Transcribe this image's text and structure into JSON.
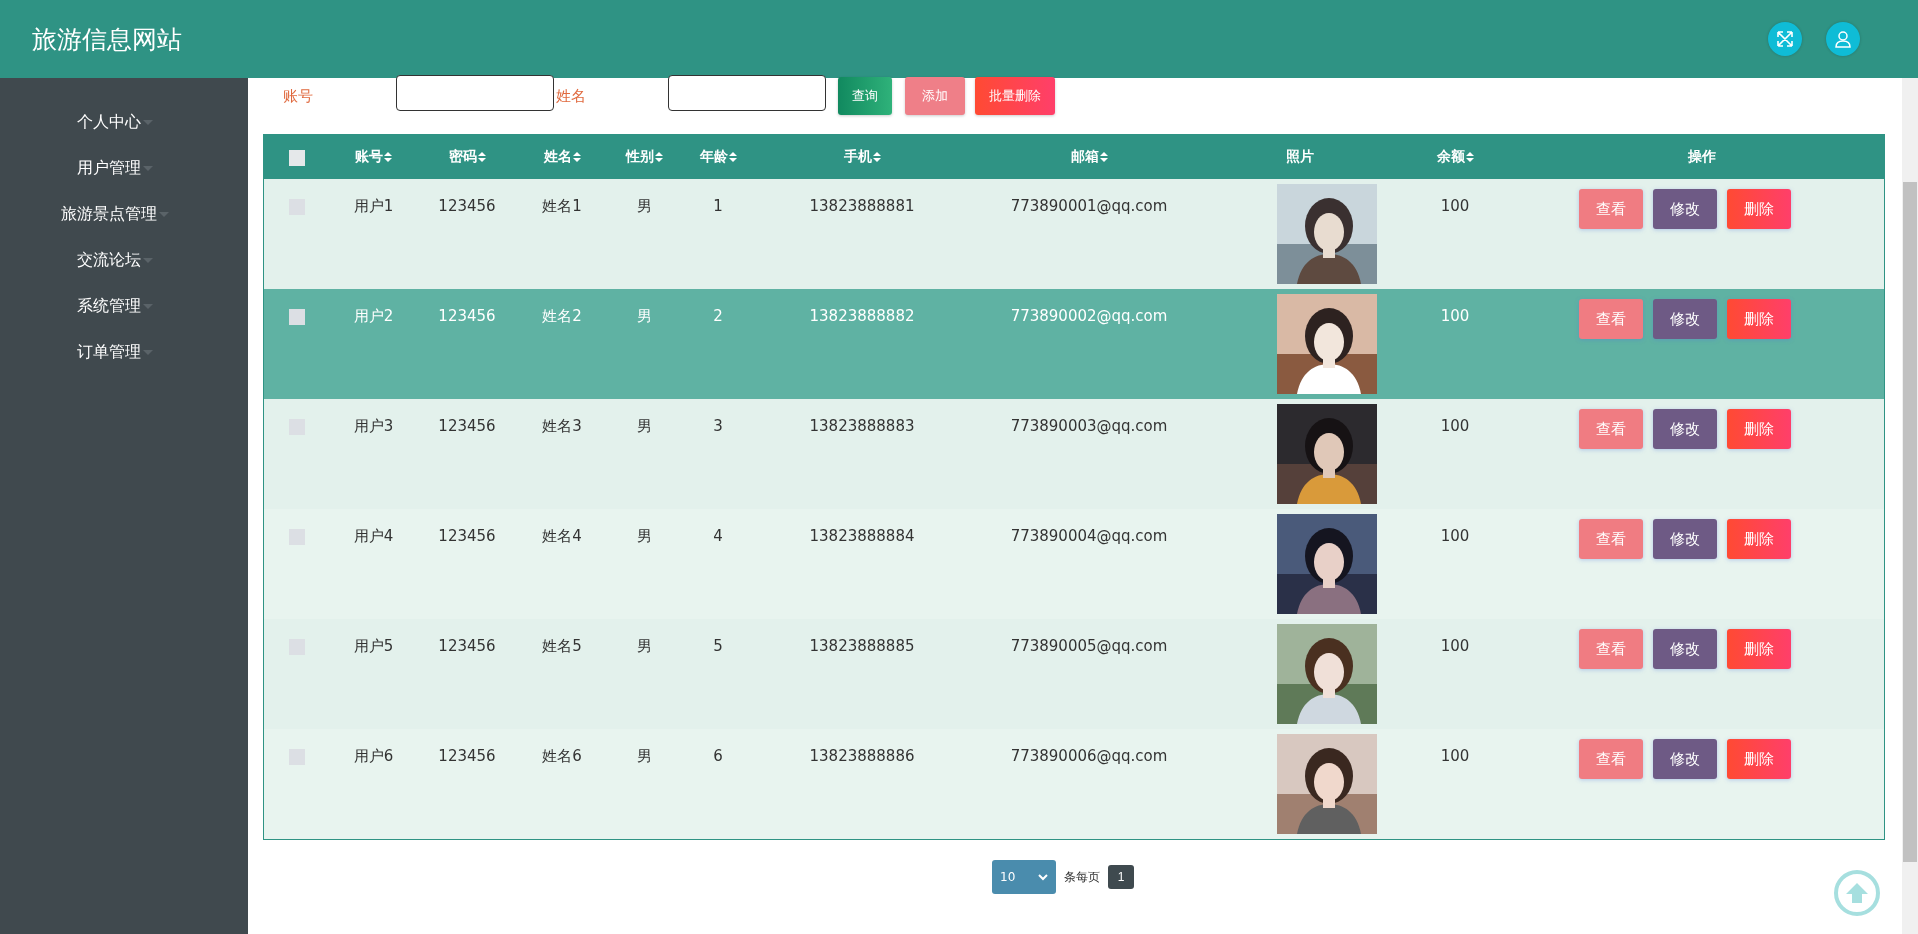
{
  "header": {
    "title": "旅游信息网站"
  },
  "sidebar": {
    "items": [
      {
        "label": "个人中心"
      },
      {
        "label": "用户管理"
      },
      {
        "label": "旅游景点管理"
      },
      {
        "label": "交流论坛"
      },
      {
        "label": "系统管理"
      },
      {
        "label": "订单管理"
      }
    ]
  },
  "search": {
    "fields": [
      {
        "label": "账号"
      },
      {
        "label": "姓名"
      }
    ],
    "buttons": [
      {
        "label": "查询",
        "kind": "query"
      },
      {
        "label": "添加",
        "kind": "add"
      },
      {
        "label": "批量删除",
        "kind": "delete"
      }
    ]
  },
  "table": {
    "select_all": {
      "checked": false
    },
    "columns": [
      {
        "label": "账号",
        "sortable": true
      },
      {
        "label": "密码",
        "sortable": true
      },
      {
        "label": "姓名",
        "sortable": true
      },
      {
        "label": "性别",
        "sortable": true
      },
      {
        "label": "年龄",
        "sortable": true
      },
      {
        "label": "手机",
        "sortable": true
      },
      {
        "label": "邮箱",
        "sortable": true
      },
      {
        "label": "照片",
        "sortable": false
      },
      {
        "label": "余额",
        "sortable": true
      },
      {
        "label": "操作",
        "sortable": false
      }
    ],
    "rows": [
      {
        "checked": false,
        "highlighted": false,
        "cells": [
          "用户1",
          "123456",
          "姓名1",
          "男",
          "1",
          "13823888881",
          "773890001@qq.com"
        ],
        "balance": "100",
        "actions": [
          {
            "label": "查看",
            "kind": "view"
          },
          {
            "label": "修改",
            "kind": "edit"
          },
          {
            "label": "删除",
            "kind": "delete"
          }
        ]
      },
      {
        "checked": false,
        "highlighted": true,
        "cells": [
          "用户2",
          "123456",
          "姓名2",
          "男",
          "2",
          "13823888882",
          "773890002@qq.com"
        ],
        "balance": "100",
        "actions": [
          {
            "label": "查看",
            "kind": "view"
          },
          {
            "label": "修改",
            "kind": "edit"
          },
          {
            "label": "删除",
            "kind": "delete"
          }
        ]
      },
      {
        "checked": false,
        "highlighted": false,
        "cells": [
          "用户3",
          "123456",
          "姓名3",
          "男",
          "3",
          "13823888883",
          "773890003@qq.com"
        ],
        "balance": "100",
        "actions": [
          {
            "label": "查看",
            "kind": "view"
          },
          {
            "label": "修改",
            "kind": "edit"
          },
          {
            "label": "删除",
            "kind": "delete"
          }
        ]
      },
      {
        "checked": false,
        "highlighted": false,
        "cells": [
          "用户4",
          "123456",
          "姓名4",
          "男",
          "4",
          "13823888884",
          "773890004@qq.com"
        ],
        "balance": "100",
        "actions": [
          {
            "label": "查看",
            "kind": "view"
          },
          {
            "label": "修改",
            "kind": "edit"
          },
          {
            "label": "删除",
            "kind": "delete"
          }
        ]
      },
      {
        "checked": false,
        "highlighted": false,
        "cells": [
          "用户5",
          "123456",
          "姓名5",
          "男",
          "5",
          "13823888885",
          "773890005@qq.com"
        ],
        "balance": "100",
        "actions": [
          {
            "label": "查看",
            "kind": "view"
          },
          {
            "label": "修改",
            "kind": "edit"
          },
          {
            "label": "删除",
            "kind": "delete"
          }
        ]
      },
      {
        "checked": false,
        "highlighted": false,
        "cells": [
          "用户6",
          "123456",
          "姓名6",
          "男",
          "6",
          "13823888886",
          "773890006@qq.com"
        ],
        "balance": "100",
        "actions": [
          {
            "label": "查看",
            "kind": "view"
          },
          {
            "label": "修改",
            "kind": "edit"
          },
          {
            "label": "删除",
            "kind": "delete"
          }
        ]
      }
    ]
  },
  "pagination": {
    "page_size": "10",
    "per_page_label": "条每页",
    "pages": [
      {
        "label": "1",
        "selected": true
      }
    ]
  }
}
